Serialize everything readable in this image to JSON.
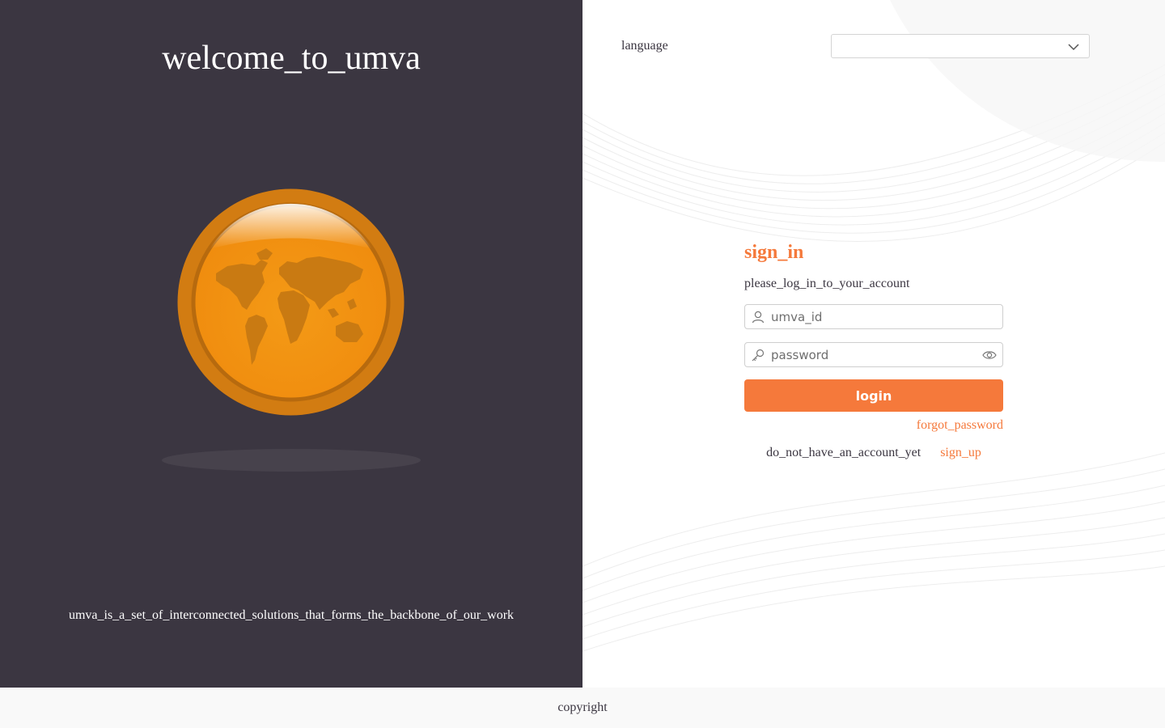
{
  "left_panel": {
    "title": "welcome_to_umva",
    "tagline": "umva_is_a_set_of_interconnected_solutions_that_forms_the_backbone_of_our_work",
    "logo_icon": "globe-coin-icon"
  },
  "header": {
    "language_label": "language",
    "language_value": ""
  },
  "signin": {
    "title": "sign_in",
    "subtitle": "please_log_in_to_your_account",
    "id_placeholder": "umva_id",
    "password_placeholder": "password",
    "login_label": "login",
    "forgot_password": "forgot_password",
    "no_account": "do_not_have_an_account_yet",
    "sign_up": "sign_up"
  },
  "footer": {
    "copyright": "copyright"
  },
  "colors": {
    "left_bg": "#3b3641",
    "accent": "#f5793b",
    "coin_outer": "#d47d10",
    "coin_inner": "#f39313"
  }
}
